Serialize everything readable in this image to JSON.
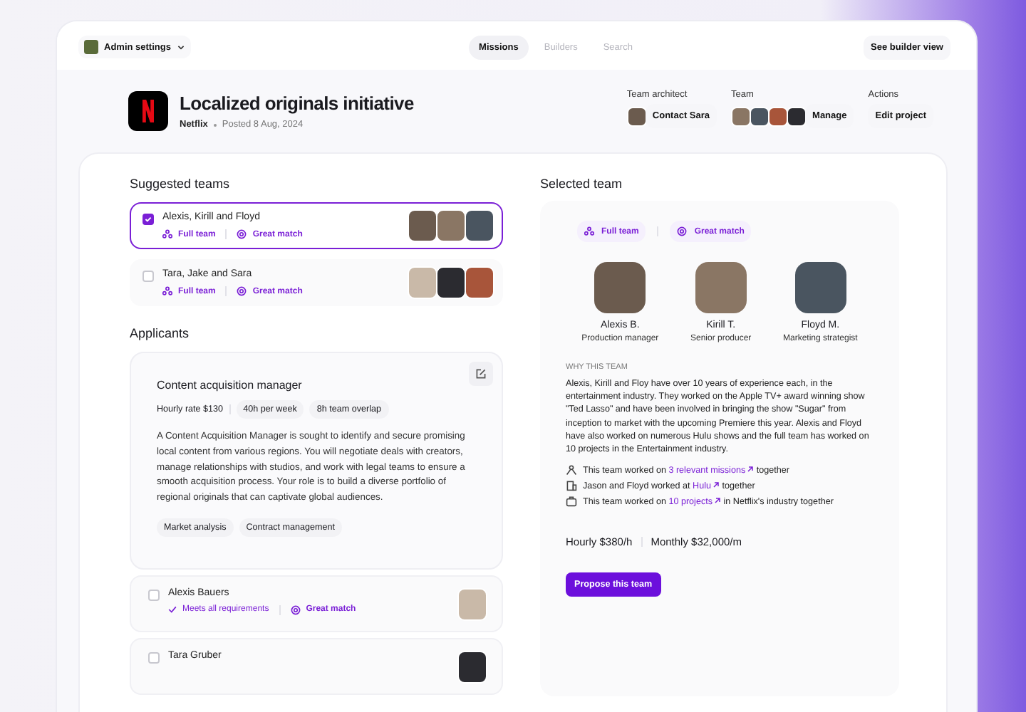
{
  "nav": {
    "account": "Admin settings",
    "tabs": [
      {
        "label": "Missions",
        "selected": true
      },
      {
        "label": "Builders",
        "selected": false
      },
      {
        "label": "Search",
        "selected": false
      }
    ],
    "action": "See builder view"
  },
  "header": {
    "title": "Localized originals initiative",
    "company": "Netflix",
    "posted": "Posted 8 Aug, 2024",
    "architect": {
      "label": "Team architect",
      "button": "Contact Sara"
    },
    "team": {
      "label": "Team",
      "button": "Manage"
    },
    "actions": {
      "label": "Actions",
      "button": "Edit project"
    }
  },
  "suggested": {
    "title": "Suggested teams",
    "teams": [
      {
        "names": "Alexis, Kirill and Floyd",
        "tags": [
          "Full team",
          "Great match"
        ],
        "selected": true
      },
      {
        "names": "Tara, Jake and Sara",
        "tags": [
          "Full team",
          "Great match"
        ],
        "selected": false
      }
    ]
  },
  "applicants": {
    "title": "Applicants",
    "role": {
      "title": "Content acquisition manager",
      "rate": "Hourly rate $130",
      "chips": [
        "40h per week",
        "8h team overlap"
      ],
      "description": "A Content Acquisition Manager is sought to identify and secure promising local content from various regions. You will negotiate deals with creators, manage relationships with studios, and work with legal teams to ensure a smooth acquisition process. Your role is to build a diverse portfolio of regional originals that can captivate global audiences.",
      "skills": [
        "Market analysis",
        "Contract management"
      ]
    },
    "people": [
      {
        "name": "Alexis Bauers",
        "requirement": "Meets all requirements",
        "match": "Great match",
        "checked": false
      },
      {
        "name": "Tara Gruber",
        "checked": false
      }
    ]
  },
  "selected_team": {
    "title": "Selected team",
    "tags": [
      "Full team",
      "Great match"
    ],
    "members": [
      {
        "name": "Alexis B.",
        "role": "Production manager"
      },
      {
        "name": "Kirill T.",
        "role": "Senior producer"
      },
      {
        "name": "Floyd M.",
        "role": "Marketing strategist"
      }
    ],
    "why_label": "WHY THIS TEAM",
    "why_text": "Alexis, Kirill and Floy have over 10 years of experience each, in the entertainment industry. They worked on the Apple TV+ award winning show \"Ted Lasso\" and have been involved in bringing the show \"Sugar\" from inception to market with the upcoming Premiere this year. Alexis and Floyd have also worked on numerous Hulu shows and the full team has worked on 10 projects in the Entertainment industry.",
    "reasons": [
      {
        "kind": "missions",
        "before": "This team worked on",
        "link": "3 relevant missions",
        "after": "together"
      },
      {
        "kind": "company",
        "before": "Jason and Floyd worked at",
        "link": "Hulu",
        "after": "together"
      },
      {
        "kind": "projects",
        "before": "This team worked on",
        "link": "10 projects",
        "after": "in Netflix's industry together"
      }
    ],
    "hourly": "Hourly $380/h",
    "monthly": "Monthly $32,000/m",
    "button": "Propose this team"
  }
}
